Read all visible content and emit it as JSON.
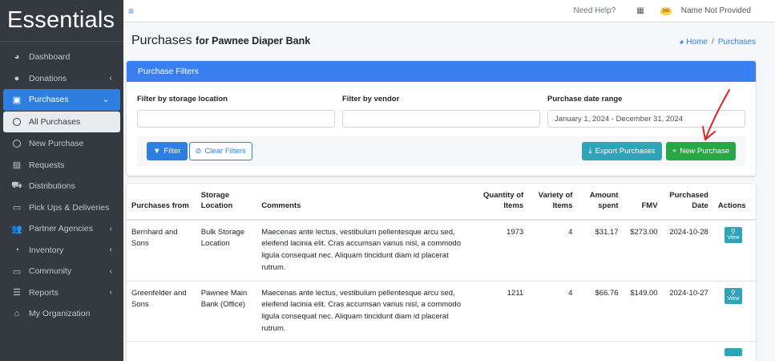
{
  "brand": "Essentials",
  "sidebar": {
    "items": [
      {
        "label": "Dashboard",
        "icon": "dashboard-icon",
        "glyph": "◕"
      },
      {
        "label": "Donations",
        "icon": "donations-icon",
        "glyph": "●",
        "chevron": "‹"
      },
      {
        "label": "Purchases",
        "icon": "purchases-icon",
        "glyph": "▣",
        "chevron": "⌄"
      },
      {
        "label": "All Purchases",
        "icon": "circle-icon"
      },
      {
        "label": "New Purchase",
        "icon": "circle-icon"
      },
      {
        "label": "Requests",
        "icon": "requests-icon",
        "glyph": "▤"
      },
      {
        "label": "Distributions",
        "icon": "cart-icon",
        "glyph": "⛟"
      },
      {
        "label": "Pick Ups & Deliveries",
        "icon": "calendar-icon",
        "glyph": "▭"
      },
      {
        "label": "Partner Agencies",
        "icon": "users-icon",
        "glyph": "👥",
        "chevron": "‹"
      },
      {
        "label": "Inventory",
        "icon": "pie-icon",
        "glyph": "◔",
        "chevron": "‹"
      },
      {
        "label": "Community",
        "icon": "laptop-icon",
        "glyph": "▭",
        "chevron": "‹"
      },
      {
        "label": "Reports",
        "icon": "list-icon",
        "glyph": "☰",
        "chevron": "‹"
      },
      {
        "label": "My Organization",
        "icon": "home-icon",
        "glyph": "⌂"
      }
    ]
  },
  "topbar": {
    "help": "Need Help?",
    "avatar_badge": "260",
    "user": "Name Not Provided"
  },
  "header": {
    "title": "Purchases",
    "subtitle": "for Pawnee Diaper Bank",
    "breadcrumb_home": "Home",
    "breadcrumb_sep": "/",
    "breadcrumb_current": "Purchases"
  },
  "filters": {
    "title": "Purchase Filters",
    "storage_label": "Filter by storage location",
    "storage_value": "",
    "vendor_label": "Filter by vendor",
    "vendor_value": "",
    "date_label": "Purchase date range",
    "date_value": "January 1, 2024 - December 31, 2024",
    "filter_btn": "Filter",
    "clear_btn": "Clear Filters",
    "export_btn": "Export Purchases",
    "new_btn": "New Purchase"
  },
  "table": {
    "headers": {
      "from": "Purchases from",
      "location": "Storage Location",
      "comments": "Comments",
      "quantity": "Quantity of Items",
      "variety": "Variety of Items",
      "amount": "Amount spent",
      "fmv": "FMV",
      "date": "Purchased Date",
      "actions": "Actions"
    },
    "rows": [
      {
        "from": "Bernhard and Sons",
        "location": "Bulk Storage Location",
        "comments": "Maecenas ante lectus, vestibulum pellentesque arcu sed, eleifend lacinia elit. Cras accumsan varius nisl, a commodo ligula consequat nec. Aliquam tincidunt diam id placerat rutrum.",
        "quantity": "1973",
        "variety": "4",
        "amount": "$31.17",
        "fmv": "$273.00",
        "date": "2024-10-28",
        "action": "View"
      },
      {
        "from": "Greenfelder and Sons",
        "location": "Pawnee Main Bank (Office)",
        "comments": "Maecenas ante lectus, vestibulum pellentesque arcu sed, eleifend lacinia elit. Cras accumsan varius nisl, a commodo ligula consequat nec. Aliquam tincidunt diam id placerat rutrum.",
        "quantity": "1211",
        "variety": "4",
        "amount": "$66.76",
        "fmv": "$149.00",
        "date": "2024-10-27",
        "action": "View"
      },
      {
        "from": "",
        "location": "",
        "comments": "",
        "quantity": "",
        "variety": "",
        "amount": "",
        "fmv": "",
        "date": "",
        "action": ""
      }
    ]
  },
  "colors": {
    "sidebar_bg": "#343a40",
    "primary": "#2f7fe0",
    "info": "#2fa3b8",
    "success": "#28a745",
    "annotation": "#e02020"
  }
}
